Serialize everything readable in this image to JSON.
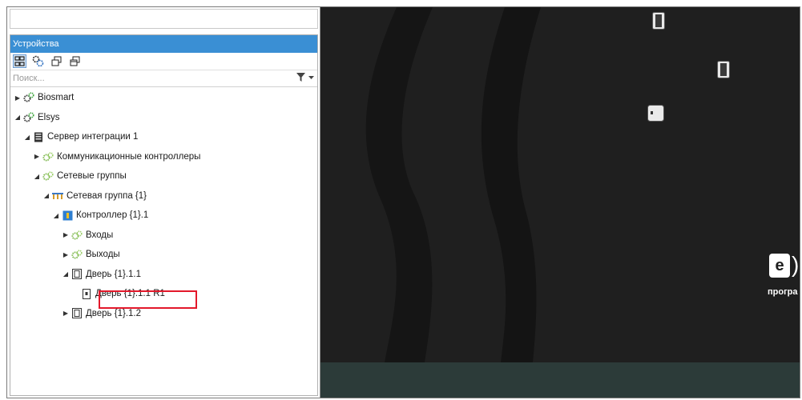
{
  "panel": {
    "title": "Устройства",
    "search_placeholder": "Поиск..."
  },
  "toolbar": {
    "icons": [
      "hierarchy-icon",
      "gear-network-icon",
      "window-icon",
      "window-copy-icon"
    ]
  },
  "tree": [
    {
      "label": "Biosmart",
      "level": 0,
      "expanded": false,
      "icon": "gears-icon"
    },
    {
      "label": "Elsys",
      "level": 0,
      "expanded": true,
      "icon": "gears-icon"
    },
    {
      "label": "Сервер интеграции 1",
      "level": 1,
      "expanded": true,
      "icon": "server-icon"
    },
    {
      "label": "Коммуникационные контроллеры",
      "level": 2,
      "expanded": false,
      "icon": "green-gears-icon"
    },
    {
      "label": "Сетевые группы",
      "level": 2,
      "expanded": true,
      "icon": "green-gears-icon"
    },
    {
      "label": "Сетевая группа {1}",
      "level": 3,
      "expanded": true,
      "icon": "network-group-icon"
    },
    {
      "label": "Контроллер {1}.1",
      "level": 4,
      "expanded": true,
      "icon": "controller-icon"
    },
    {
      "label": "Входы",
      "level": 5,
      "expanded": false,
      "icon": "green-gears-icon"
    },
    {
      "label": "Выходы",
      "level": 5,
      "expanded": false,
      "icon": "green-gears-icon"
    },
    {
      "label": "Дверь {1}.1.1",
      "level": 5,
      "expanded": true,
      "icon": "door-icon"
    },
    {
      "label": "Дверь {1}.1.1 R1",
      "level": 6,
      "expanded": null,
      "icon": "reader-icon",
      "selected": true
    },
    {
      "label": "Дверь {1}.1.2",
      "level": 5,
      "expanded": false,
      "icon": "door-icon"
    }
  ],
  "brand": {
    "logo_letter": "e",
    "tagline": "програ"
  },
  "colors": {
    "header_blue": "#3a8fd4",
    "highlight_red": "#e3182a",
    "dark_bg": "#1e1e1e",
    "bottom_bar": "#2c3b39"
  }
}
